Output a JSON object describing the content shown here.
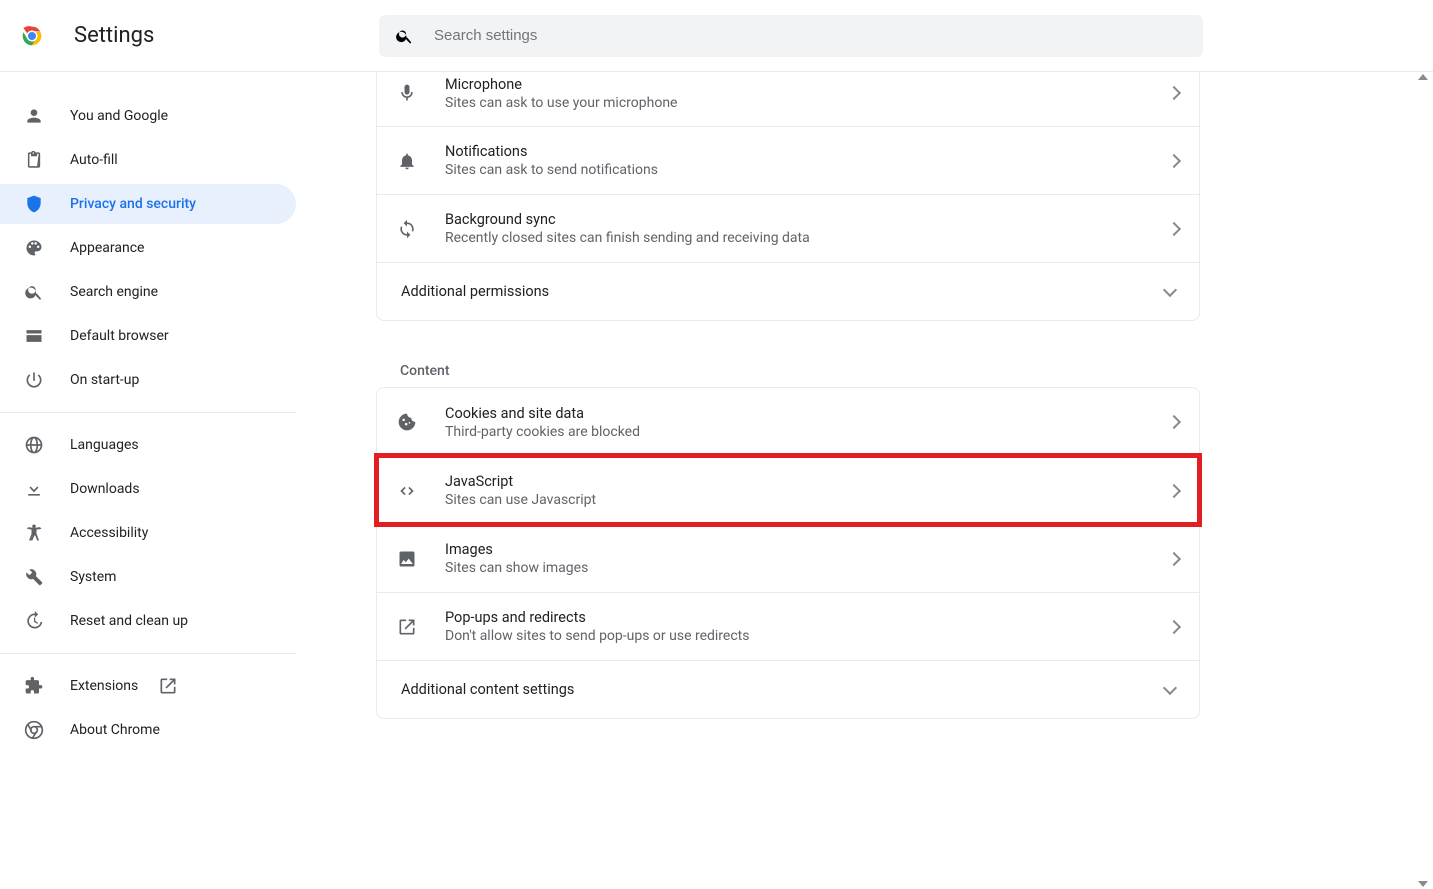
{
  "header": {
    "title": "Settings",
    "search_placeholder": "Search settings"
  },
  "sidebar": {
    "groups": [
      {
        "items": [
          {
            "label": "You and Google",
            "icon": "person",
            "active": false
          },
          {
            "label": "Auto-fill",
            "icon": "clipboard",
            "active": false
          },
          {
            "label": "Privacy and security",
            "icon": "shield",
            "active": true
          },
          {
            "label": "Appearance",
            "icon": "palette",
            "active": false
          },
          {
            "label": "Search engine",
            "icon": "search",
            "active": false
          },
          {
            "label": "Default browser",
            "icon": "browser",
            "active": false
          },
          {
            "label": "On start-up",
            "icon": "power",
            "active": false
          }
        ]
      },
      {
        "items": [
          {
            "label": "Languages",
            "icon": "globe",
            "active": false
          },
          {
            "label": "Downloads",
            "icon": "download",
            "active": false
          },
          {
            "label": "Accessibility",
            "icon": "accessibility",
            "active": false
          },
          {
            "label": "System",
            "icon": "wrench",
            "active": false
          },
          {
            "label": "Reset and clean up",
            "icon": "history",
            "active": false
          }
        ]
      },
      {
        "items": [
          {
            "label": "Extensions",
            "icon": "puzzle",
            "external": true,
            "active": false
          },
          {
            "label": "About Chrome",
            "icon": "chrome",
            "active": false
          }
        ]
      }
    ]
  },
  "main": {
    "permission_rows": [
      {
        "title": "Microphone",
        "sub": "Sites can ask to use your microphone",
        "icon": "mic",
        "highlight": false
      },
      {
        "title": "Notifications",
        "sub": "Sites can ask to send notifications",
        "icon": "bell",
        "highlight": false
      },
      {
        "title": "Background sync",
        "sub": "Recently closed sites can finish sending and receiving data",
        "icon": "sync",
        "highlight": false
      }
    ],
    "permissions_expander": "Additional permissions",
    "content_header": "Content",
    "content_rows": [
      {
        "title": "Cookies and site data",
        "sub": "Third-party cookies are blocked",
        "icon": "cookie",
        "highlight": false
      },
      {
        "title": "JavaScript",
        "sub": "Sites can use Javascript",
        "icon": "code",
        "highlight": true
      },
      {
        "title": "Images",
        "sub": "Sites can show images",
        "icon": "image",
        "highlight": false
      },
      {
        "title": "Pop-ups and redirects",
        "sub": "Don't allow sites to send pop-ups or use redirects",
        "icon": "openext",
        "highlight": false
      }
    ],
    "content_expander": "Additional content settings"
  }
}
